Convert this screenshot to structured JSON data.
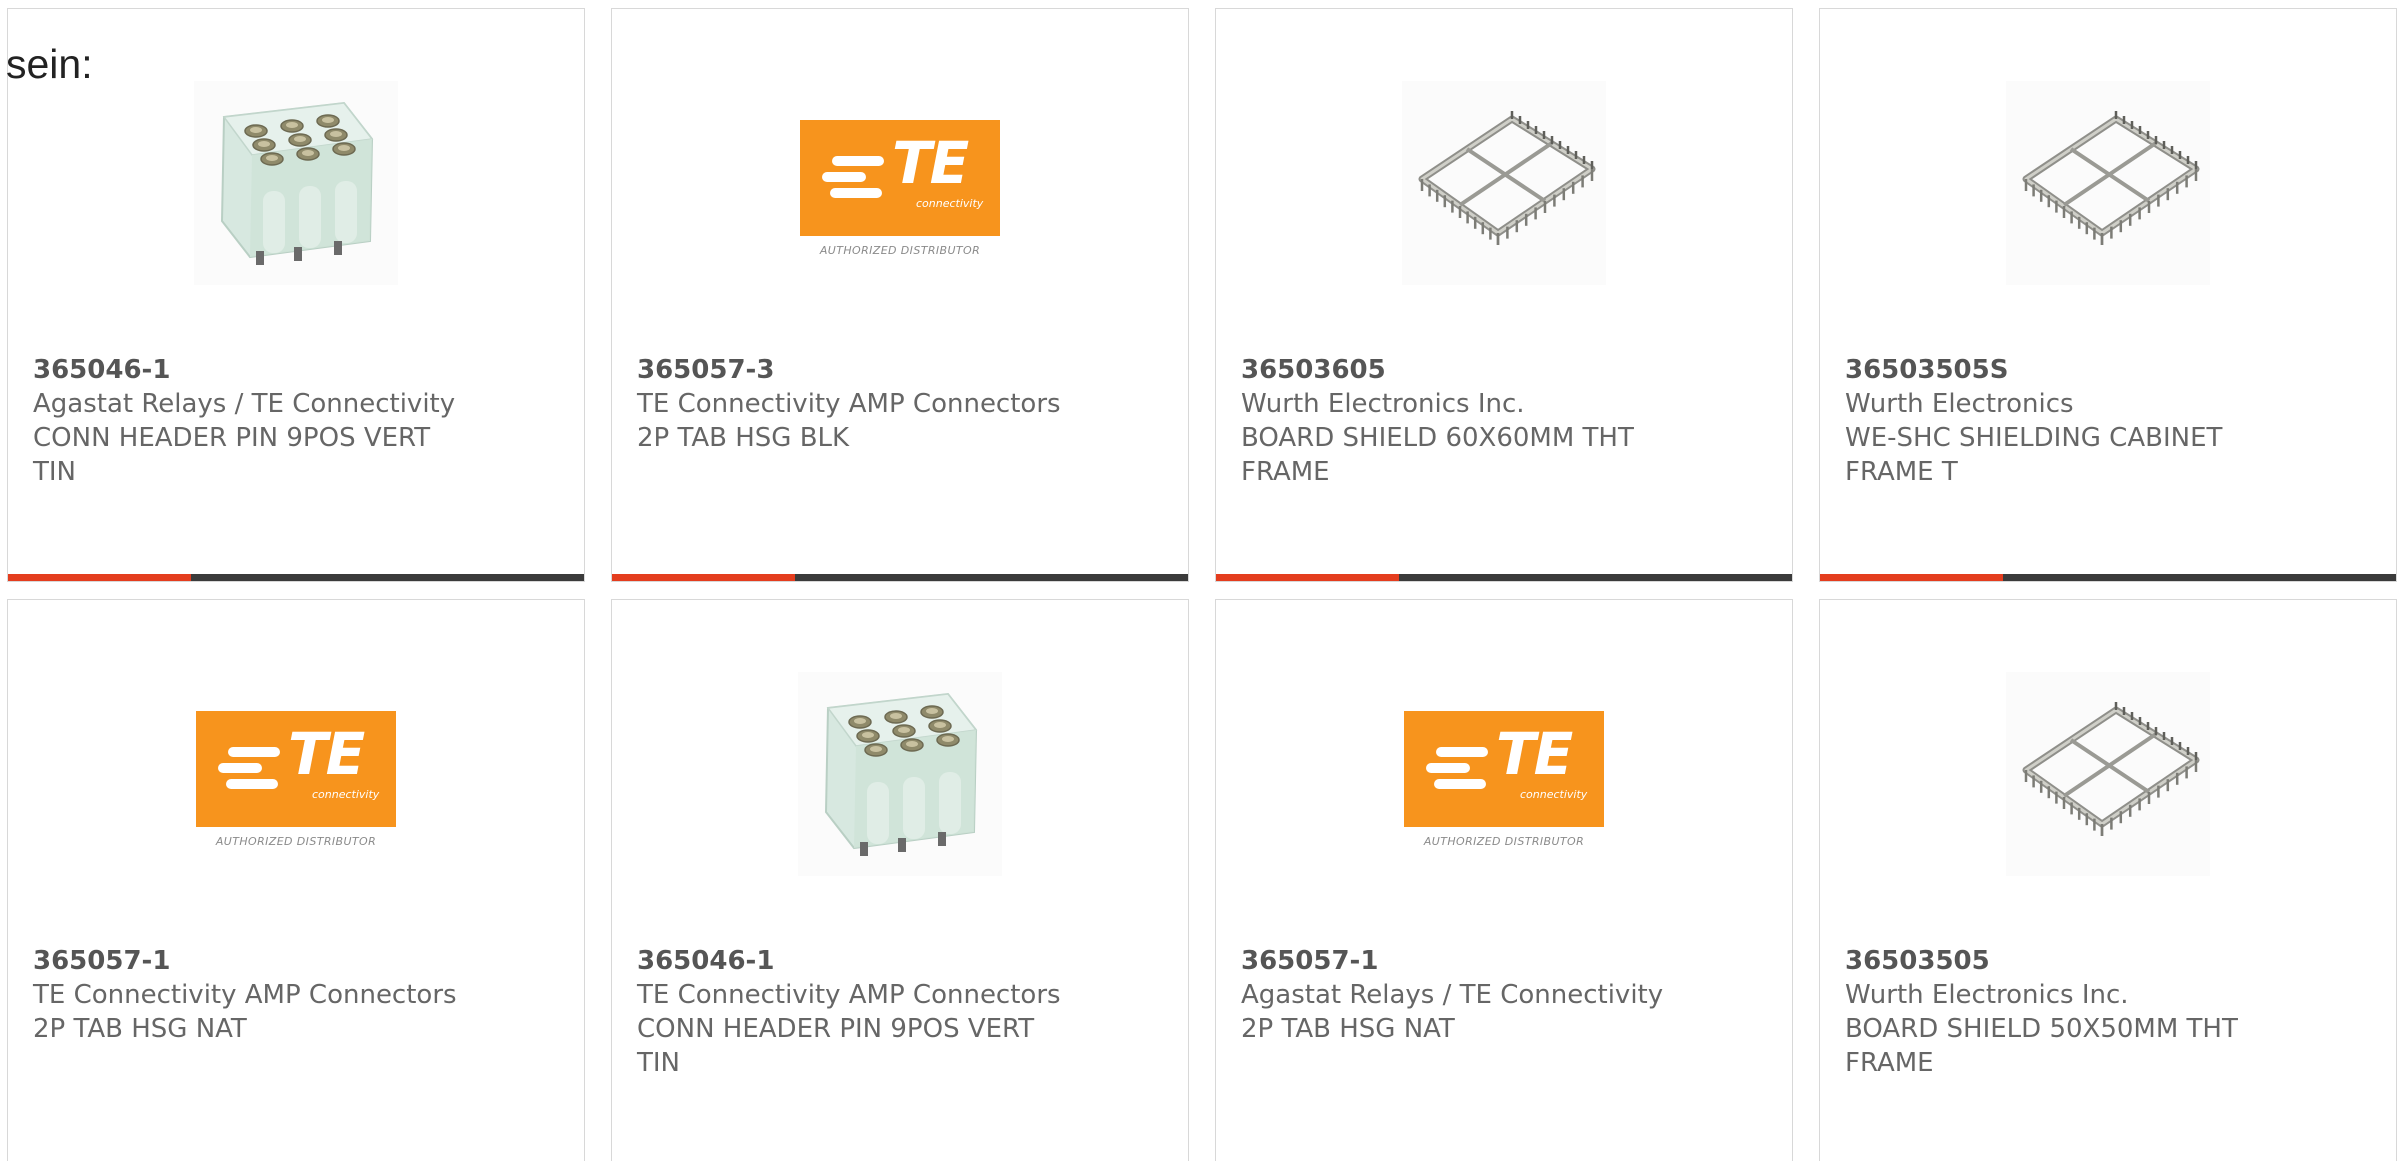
{
  "intro_text": "sein:",
  "brand": {
    "accent_color": "#e43d1e",
    "bar_color": "#3b3b3b",
    "te_orange": "#f7941d"
  },
  "te_logo": {
    "mark": "TE",
    "tagline": "connectivity",
    "caption": "AUTHORIZED DISTRIBUTOR"
  },
  "products": [
    {
      "part_number": "365046-1",
      "manufacturer": "Agastat Relays / TE Connectivity",
      "description": "CONN HEADER PIN 9POS VERT TIN",
      "image": "connector-header-photo"
    },
    {
      "part_number": "365057-3",
      "manufacturer": "TE Connectivity AMP Connectors",
      "description": "2P TAB HSG BLK",
      "image": "te-connectivity-logo"
    },
    {
      "part_number": "36503605",
      "manufacturer": "Wurth Electronics Inc.",
      "description": "BOARD SHIELD 60X60MM THT FRAME",
      "image": "shield-frame-photo"
    },
    {
      "part_number": "36503505S",
      "manufacturer": "Wurth Electronics",
      "description": "WE-SHC SHIELDING CABINET FRAME T",
      "image": "shield-frame-photo"
    },
    {
      "part_number": "365057-1",
      "manufacturer": "TE Connectivity AMP Connectors",
      "description": "2P TAB HSG NAT",
      "image": "te-connectivity-logo"
    },
    {
      "part_number": "365046-1",
      "manufacturer": "TE Connectivity AMP Connectors",
      "description": "CONN HEADER PIN 9POS VERT TIN",
      "image": "connector-header-photo"
    },
    {
      "part_number": "365057-1",
      "manufacturer": "Agastat Relays / TE Connectivity",
      "description": "2P TAB HSG NAT",
      "image": "te-connectivity-logo"
    },
    {
      "part_number": "36503505",
      "manufacturer": "Wurth Electronics Inc.",
      "description": "BOARD SHIELD 50X50MM THT FRAME",
      "image": "shield-frame-photo"
    }
  ]
}
